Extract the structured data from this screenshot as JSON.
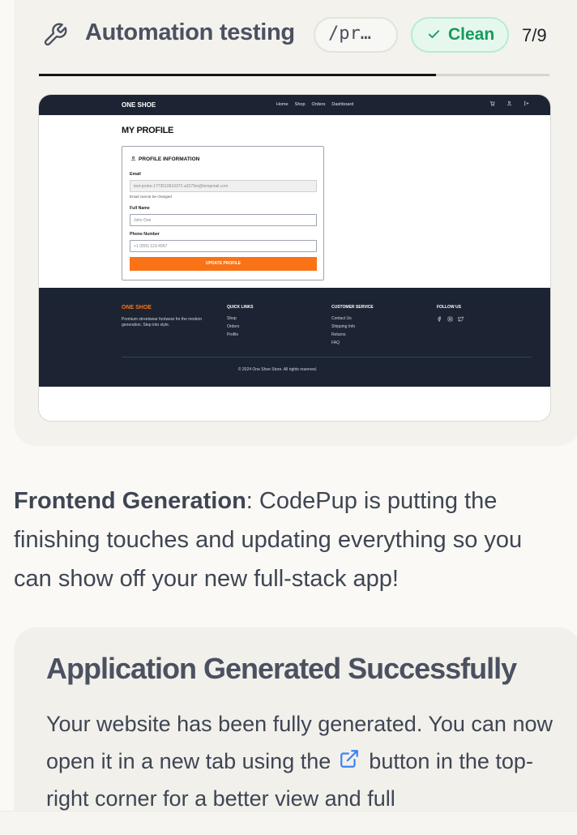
{
  "header": {
    "title": "Automation testing",
    "path_pill": "/pr…",
    "status_badge": "Clean",
    "counter": "7/9",
    "progress_fraction": 0.778
  },
  "preview": {
    "nav": {
      "brand": "ONE SHOE",
      "links": [
        "Home",
        "Shop",
        "Orders",
        "Dashboard"
      ]
    },
    "page_title": "MY PROFILE",
    "profile_card": {
      "heading": "PROFILE INFORMATION",
      "email_label": "Email",
      "email_value": "test-probe-1773510616372-a3379m@tempmail.com",
      "email_note": "Email cannot be changed",
      "name_label": "Full Name",
      "name_placeholder": "John Doe",
      "phone_label": "Phone Number",
      "phone_placeholder": "+1 (555) 123-4567",
      "button": "UPDATE PROFILE"
    },
    "footer": {
      "brand": "ONE SHOE",
      "description": "Premium streetwear footwear for the modern generation. Step into style.",
      "quick_links_heading": "QUICK LINKS",
      "quick_links": [
        "Shop",
        "Orders",
        "Profile"
      ],
      "customer_service_heading": "CUSTOMER SERVICE",
      "customer_service": [
        "Contact Us",
        "Shipping Info",
        "Returns",
        "FAQ"
      ],
      "follow_heading": "FOLLOW US",
      "copyright": "© 2024 One Shoe Store. All rights reserved."
    }
  },
  "message": {
    "bold": "Frontend Generation",
    "text": ": CodePup is putting the finishing touches and updating everything so you can show off your new full-stack app!"
  },
  "success_card": {
    "title": "Application Generated Successfully",
    "body_before": "Your website has been fully generated. You can now open it in a new tab using the",
    "body_after": "button in the top-right corner for a better view and full"
  },
  "colors": {
    "accent_orange": "#f97316",
    "nav_dark": "#1c2433",
    "clean_green": "#169a5b",
    "link_blue": "#3b82f6"
  }
}
